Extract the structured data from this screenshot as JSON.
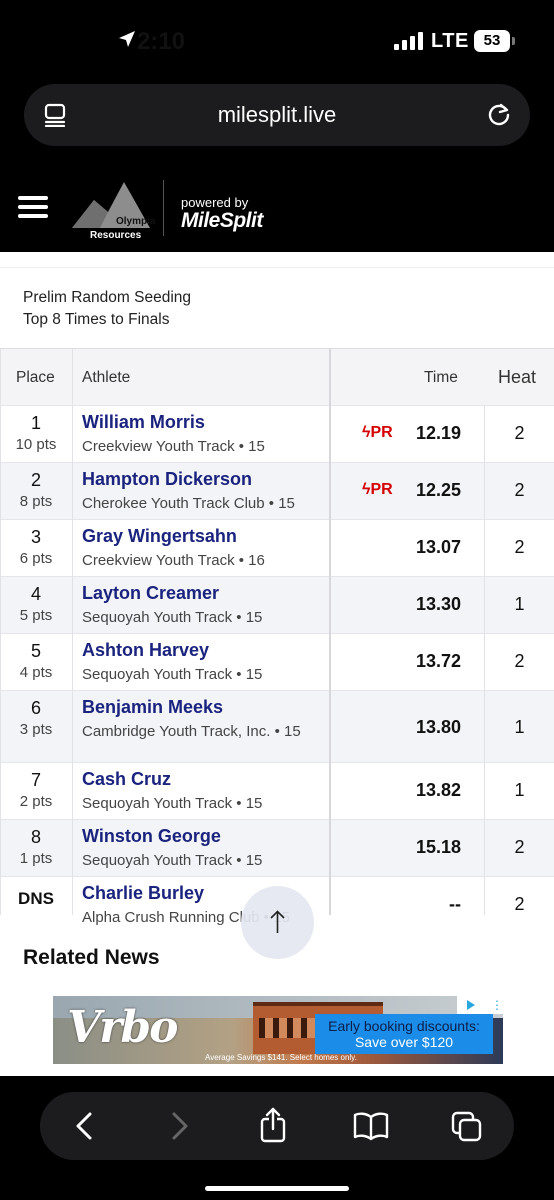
{
  "status_bar": {
    "time": "2:10",
    "network": "LTE",
    "battery": "53"
  },
  "browser": {
    "url": "milesplit.live"
  },
  "header": {
    "logo_line1": "Olympia",
    "logo_line2": "Resources",
    "powered_by": "powered by",
    "brand": "MileSplit"
  },
  "event": {
    "note_line1": "Prelim Random Seeding",
    "note_line2": "Top 8 Times to Finals"
  },
  "table": {
    "headers": {
      "place": "Place",
      "athlete": "Athlete",
      "time": "Time",
      "heat": "Heat"
    },
    "rows": [
      {
        "place": "1",
        "pts": "10 pts",
        "name": "William Morris",
        "team": "Creekview Youth Track • 15",
        "pr": "PR",
        "time": "12.19",
        "heat": "2"
      },
      {
        "place": "2",
        "pts": "8 pts",
        "name": "Hampton Dickerson",
        "team": "Cherokee Youth Track Club • 15",
        "pr": "PR",
        "time": "12.25",
        "heat": "2"
      },
      {
        "place": "3",
        "pts": "6 pts",
        "name": "Gray Wingertsahn",
        "team": "Creekview Youth Track • 16",
        "pr": "",
        "time": "13.07",
        "heat": "2"
      },
      {
        "place": "4",
        "pts": "5 pts",
        "name": "Layton Creamer",
        "team": "Sequoyah Youth Track • 15",
        "pr": "",
        "time": "13.30",
        "heat": "1"
      },
      {
        "place": "5",
        "pts": "4 pts",
        "name": "Ashton Harvey",
        "team": "Sequoyah Youth Track • 15",
        "pr": "",
        "time": "13.72",
        "heat": "2"
      },
      {
        "place": "6",
        "pts": "3 pts",
        "name": "Benjamin Meeks",
        "team": "Cambridge Youth Track, Inc. • 15",
        "pr": "",
        "time": "13.80",
        "heat": "1"
      },
      {
        "place": "7",
        "pts": "2 pts",
        "name": "Cash Cruz",
        "team": "Sequoyah Youth Track • 15",
        "pr": "",
        "time": "13.82",
        "heat": "1"
      },
      {
        "place": "8",
        "pts": "1 pts",
        "name": "Winston George",
        "team": "Sequoyah Youth Track • 15",
        "pr": "",
        "time": "15.18",
        "heat": "2"
      },
      {
        "place": "DNS",
        "pts": "",
        "name": "Charlie Burley",
        "team": "Alpha Crush Running Club • 15",
        "pr": "",
        "time": "--",
        "heat": "2"
      }
    ]
  },
  "related_news": "Related News",
  "ad": {
    "brand": "Vrbo",
    "line1": "Early booking discounts:",
    "line2": "Save over $120",
    "fine_print": "Average Savings $141. Select homes only."
  },
  "colors": {
    "pr_red": "#d50000",
    "athlete_blue": "#1a237e",
    "ad_blue": "#1b8ce8"
  }
}
